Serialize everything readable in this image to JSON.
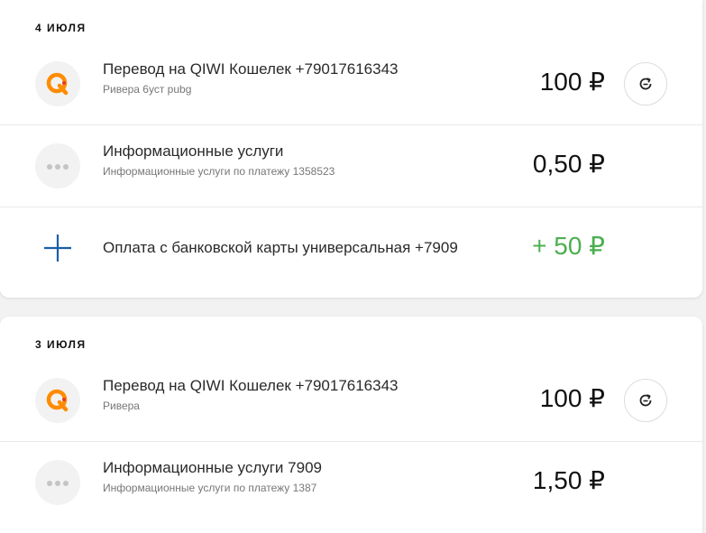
{
  "groups": [
    {
      "date": "4 ИЮЛЯ",
      "items": [
        {
          "icon": "qiwi-logo-icon",
          "title": "Перевод на QIWI Кошелек +79017616343",
          "subtitle": "Ривера 6уст pubg",
          "amount": "100 ₽",
          "has_repeat": true
        },
        {
          "icon": "dots-icon",
          "title": "Информационные услуги",
          "subtitle": "Информационные услуги по платежу 1358523",
          "amount": "0,50 ₽",
          "has_repeat": false
        },
        {
          "icon": "plus-icon",
          "title": "Оплата с банковской карты универсальная +7909",
          "subtitle": "",
          "amount": "+ 50 ₽",
          "has_repeat": false
        }
      ]
    },
    {
      "date": "3 ИЮЛЯ",
      "items": [
        {
          "icon": "qiwi-logo-icon",
          "title": "Перевод на QIWI Кошелек +79017616343",
          "subtitle": "Ривера",
          "amount": "100 ₽",
          "has_repeat": true
        },
        {
          "icon": "dots-icon",
          "title": "Информационные услуги 7909",
          "subtitle": "Информационные услуги по платежу 1387",
          "amount": "1,50 ₽",
          "has_repeat": false
        }
      ]
    }
  ],
  "colors": {
    "accent_orange": "#ff8c00",
    "positive_green": "#4caf50",
    "plus_icon_blue": "#1a5ea8"
  }
}
